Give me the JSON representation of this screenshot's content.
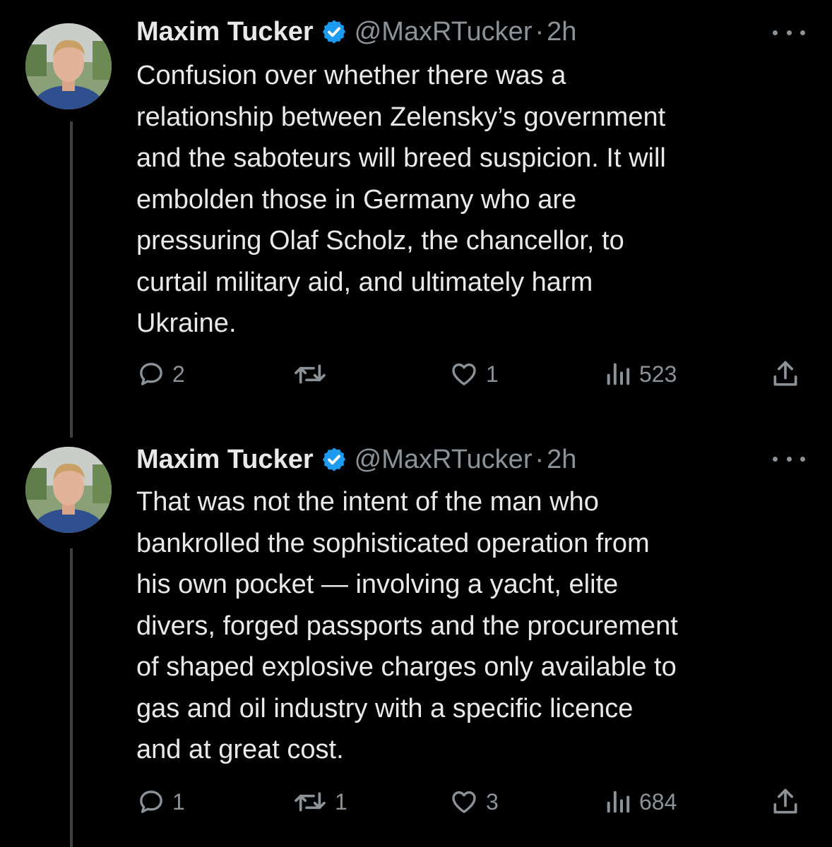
{
  "tweets": [
    {
      "name": "Maxim Tucker",
      "handle": "@MaxRTucker",
      "dot": "·",
      "time": "2h",
      "text": "Confusion over whether there was a\nrelationship between Zelensky’s government\nand the saboteurs will breed suspicion. It will\nembolden those in Germany who are\npressuring Olaf Scholz, the chancellor, to\ncurtail military aid, and ultimately harm\nUkraine.",
      "replies": "2",
      "retweets": "",
      "likes": "1",
      "views": "523"
    },
    {
      "name": "Maxim Tucker",
      "handle": "@MaxRTucker",
      "dot": "·",
      "time": "2h",
      "text": "That was not the intent of the man who\nbankrolled the sophisticated operation from\nhis own pocket — involving a yacht, elite\ndivers, forged passports and the procurement\nof shaped explosive charges only available to\ngas and oil industry with a specific licence\nand at great cost.",
      "replies": "1",
      "retweets": "1",
      "likes": "3",
      "views": "684"
    }
  ],
  "colors": {
    "background": "#000000",
    "text": "#e7e9ea",
    "muted": "#8b9298",
    "verified": "#1d9bf0",
    "thread_line": "#3e4144"
  },
  "icons": [
    "verified-badge-icon",
    "more-icon",
    "reply-icon",
    "retweet-icon",
    "like-icon",
    "views-icon",
    "share-icon"
  ]
}
